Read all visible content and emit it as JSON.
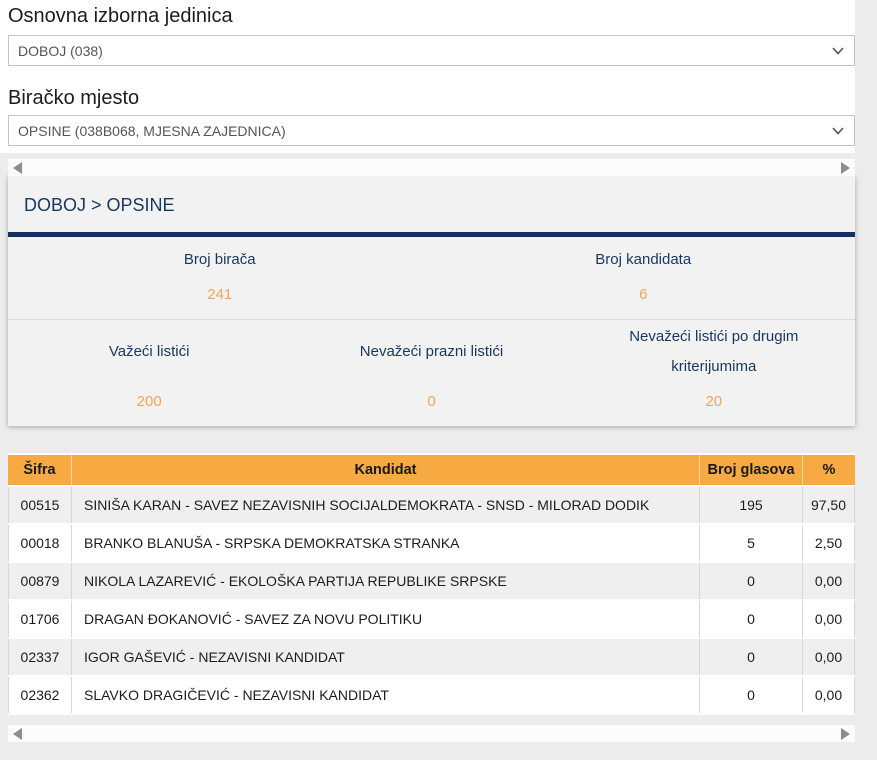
{
  "form": {
    "fields": [
      {
        "label": "Osnovna izborna jedinica",
        "value": "DOBOJ (038)"
      },
      {
        "label": "Biračko mjesto",
        "value": "OPSINE (038B068, MJESNA ZAJEDNICA)"
      }
    ]
  },
  "results": {
    "breadcrumb": "DOBOJ > OPSINE",
    "stats_row_1": [
      {
        "label": "Broj birača",
        "value": "241"
      },
      {
        "label": "Broj kandidata",
        "value": "6"
      }
    ],
    "stats_row_2": [
      {
        "label": "Važeći listići",
        "value": "200"
      },
      {
        "label": "Nevažeći prazni listići",
        "value": "0"
      },
      {
        "label": "Nevažeći listići po drugim kriterijumima",
        "value": "20"
      }
    ]
  },
  "table": {
    "headers": [
      "Šifra",
      "Kandidat",
      "Broj glasova",
      "%"
    ],
    "rows": [
      [
        "00515",
        "SINIŠA KARAN - SAVEZ NEZAVISNIH SOCIJALDEMOKRATA - SNSD - MILORAD DODIK",
        "195",
        "97,50"
      ],
      [
        "00018",
        "BRANKO BLANUŠA - SRPSKA DEMOKRATSKA STRANKA",
        "5",
        "2,50"
      ],
      [
        "00879",
        "NIKOLA LAZAREVIĆ - EKOLOŠKA PARTIJA REPUBLIKE SRPSKE",
        "0",
        "0,00"
      ],
      [
        "01706",
        "DRAGAN ĐOKANOVIĆ - SAVEZ ZA NOVU POLITIKU",
        "0",
        "0,00"
      ],
      [
        "02337",
        "IGOR GAŠEVIĆ - NEZAVISNI KANDIDAT",
        "0",
        "0,00"
      ],
      [
        "02362",
        "SLAVKO DRAGIČEVIĆ - NEZAVISNI KANDIDAT",
        "0",
        "0,00"
      ]
    ]
  },
  "colors": {
    "navy_accent": "#17375e",
    "navy_rule": "#14315c",
    "orange_table_header": "#f7a942",
    "orange_stat_value": "#eea65a"
  }
}
